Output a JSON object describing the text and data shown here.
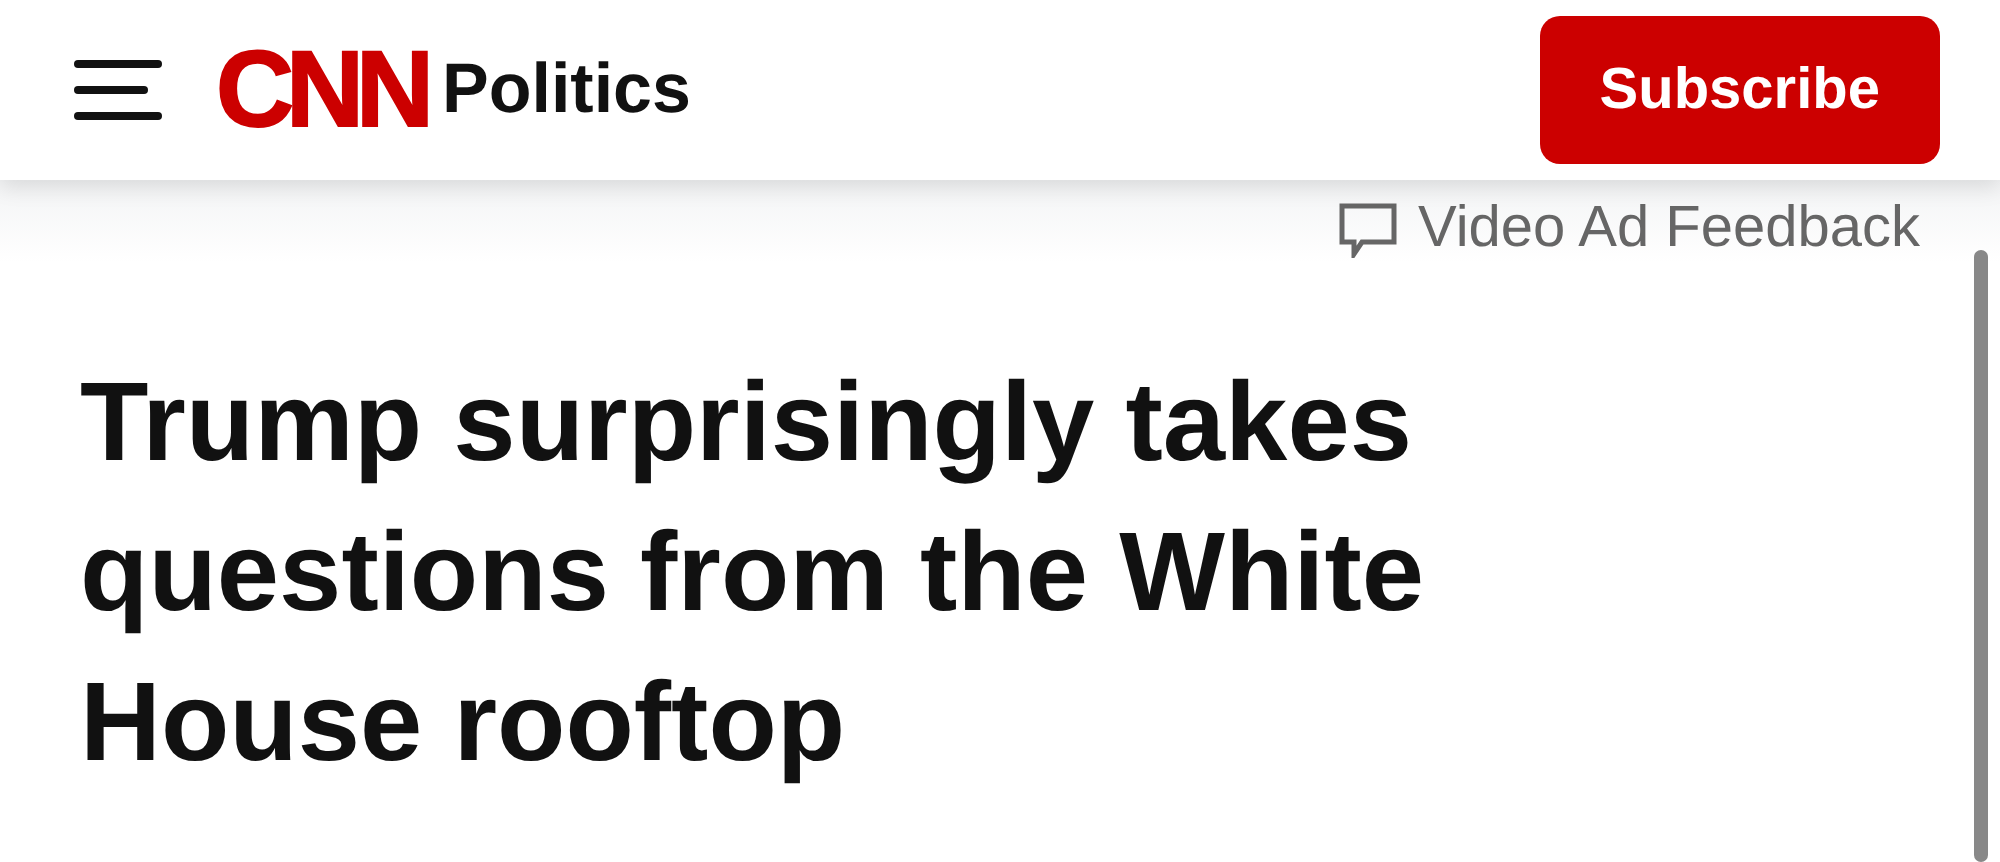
{
  "header": {
    "logo": "CNN",
    "section": "Politics",
    "subscribe_button": "Subscribe"
  },
  "ad_feedback": {
    "label": "Video Ad Feedback"
  },
  "headline": "Trump surprisingly takes questions from the White House rooftop"
}
